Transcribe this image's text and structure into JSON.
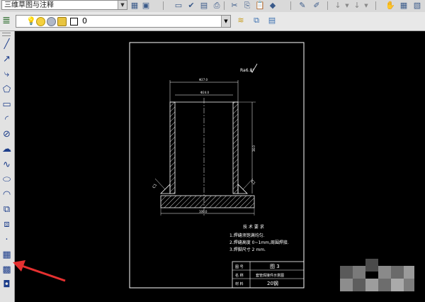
{
  "toolbar_top": {
    "text_style_value": "三维草图与注释"
  },
  "layer_toolbar": {
    "current_layer": "0"
  },
  "left_tools": [
    {
      "name": "line-tool",
      "glyph": "╱"
    },
    {
      "name": "construction-line-tool",
      "glyph": "↗"
    },
    {
      "name": "polyline-tool",
      "glyph": "⤷"
    },
    {
      "name": "polygon-tool",
      "glyph": "⬠"
    },
    {
      "name": "rectangle-tool",
      "glyph": "▭"
    },
    {
      "name": "arc-tool",
      "glyph": "◜"
    },
    {
      "name": "circle-tool",
      "glyph": "⊘"
    },
    {
      "name": "revision-cloud-tool",
      "glyph": "☁"
    },
    {
      "name": "spline-tool",
      "glyph": "∿"
    },
    {
      "name": "ellipse-tool",
      "glyph": "⬭"
    },
    {
      "name": "ellipse-arc-tool",
      "glyph": "◠"
    },
    {
      "name": "insert-block-tool",
      "glyph": "⧉"
    },
    {
      "name": "make-block-tool",
      "glyph": "⧈"
    },
    {
      "name": "point-tool",
      "glyph": "·"
    },
    {
      "name": "hatch-tool",
      "glyph": "▦"
    },
    {
      "name": "gradient-tool",
      "glyph": "▩"
    },
    {
      "name": "region-tool",
      "glyph": "◘"
    }
  ],
  "drawing": {
    "surface_mark": "Ra6.3/",
    "dim_outer_width": "Φ27.0",
    "dim_inner_width": "Φ24.0",
    "dim_height": "36.0",
    "dim_base_width": "100.0",
    "chamfer_left": "C1",
    "chamfer_right": "C1",
    "notes_title": "技 术 要 求",
    "notes": [
      "1.焊缝须饱满均匀.",
      "2.焊缝高度 0~1mm,周围焊接.",
      "3.焊脚尺寸 2 mm."
    ],
    "title_block": {
      "r1c1": "图 号",
      "r1c2": "图 3",
      "r2c1": "名 称",
      "r2c2": "套管焊接件示意图",
      "r3c1": "材 料",
      "r3c2": "20钢"
    }
  },
  "colors": {
    "canvas_bg": "#000000",
    "drawing_lines": "#ffffff",
    "arrow_annotation": "#e53030",
    "tool_icon_blue": "#1c3d8a"
  }
}
